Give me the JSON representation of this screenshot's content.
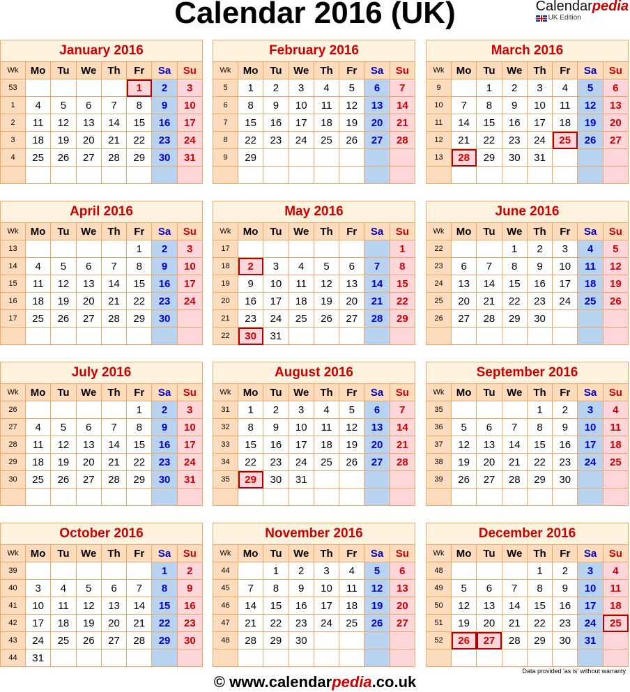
{
  "header": {
    "title": "Calendar 2016 (UK)",
    "brand_name_part1": "Calendar",
    "brand_name_part2": "pedia",
    "brand_edition": "UK Edition"
  },
  "weekday_headers": {
    "wk": "Wk",
    "days": [
      "Mo",
      "Tu",
      "We",
      "Th",
      "Fr",
      "Sa",
      "Su"
    ]
  },
  "colors": {
    "accent_red": "#cc0000",
    "saturday_blue": "#0000cc",
    "border_orange": "#f0a766",
    "header_peach": "#fddcbd",
    "saturday_bg": "#b8d3f0",
    "sunday_bg": "#ffd6d9"
  },
  "months": [
    {
      "title": "January 2016",
      "weeks": [
        {
          "wk": "53",
          "days": [
            "",
            "",
            "",
            "",
            "1",
            "2",
            "3"
          ],
          "hol": [
            4
          ]
        },
        {
          "wk": "1",
          "days": [
            "4",
            "5",
            "6",
            "7",
            "8",
            "9",
            "10"
          ]
        },
        {
          "wk": "2",
          "days": [
            "11",
            "12",
            "13",
            "14",
            "15",
            "16",
            "17"
          ]
        },
        {
          "wk": "3",
          "days": [
            "18",
            "19",
            "20",
            "21",
            "22",
            "23",
            "24"
          ]
        },
        {
          "wk": "4",
          "days": [
            "25",
            "26",
            "27",
            "28",
            "29",
            "30",
            "31"
          ]
        },
        {
          "wk": "",
          "days": [
            "",
            "",
            "",
            "",
            "",
            "",
            ""
          ]
        }
      ]
    },
    {
      "title": "February 2016",
      "weeks": [
        {
          "wk": "5",
          "days": [
            "1",
            "2",
            "3",
            "4",
            "5",
            "6",
            "7"
          ]
        },
        {
          "wk": "6",
          "days": [
            "8",
            "9",
            "10",
            "11",
            "12",
            "13",
            "14"
          ]
        },
        {
          "wk": "7",
          "days": [
            "15",
            "16",
            "17",
            "18",
            "19",
            "20",
            "21"
          ]
        },
        {
          "wk": "8",
          "days": [
            "22",
            "23",
            "24",
            "25",
            "26",
            "27",
            "28"
          ]
        },
        {
          "wk": "9",
          "days": [
            "29",
            "",
            "",
            "",
            "",
            "",
            ""
          ]
        },
        {
          "wk": "",
          "days": [
            "",
            "",
            "",
            "",
            "",
            "",
            ""
          ]
        }
      ]
    },
    {
      "title": "March 2016",
      "weeks": [
        {
          "wk": "9",
          "days": [
            "",
            "1",
            "2",
            "3",
            "4",
            "5",
            "6"
          ]
        },
        {
          "wk": "10",
          "days": [
            "7",
            "8",
            "9",
            "10",
            "11",
            "12",
            "13"
          ]
        },
        {
          "wk": "11",
          "days": [
            "14",
            "15",
            "16",
            "17",
            "18",
            "19",
            "20"
          ]
        },
        {
          "wk": "12",
          "days": [
            "21",
            "22",
            "23",
            "24",
            "25",
            "26",
            "27"
          ],
          "hol": [
            4
          ]
        },
        {
          "wk": "13",
          "days": [
            "28",
            "29",
            "30",
            "31",
            "",
            "",
            ""
          ],
          "hol": [
            0
          ]
        },
        {
          "wk": "",
          "days": [
            "",
            "",
            "",
            "",
            "",
            "",
            ""
          ]
        }
      ]
    },
    {
      "title": "April 2016",
      "weeks": [
        {
          "wk": "13",
          "days": [
            "",
            "",
            "",
            "",
            "1",
            "2",
            "3"
          ]
        },
        {
          "wk": "14",
          "days": [
            "4",
            "5",
            "6",
            "7",
            "8",
            "9",
            "10"
          ]
        },
        {
          "wk": "15",
          "days": [
            "11",
            "12",
            "13",
            "14",
            "15",
            "16",
            "17"
          ]
        },
        {
          "wk": "16",
          "days": [
            "18",
            "19",
            "20",
            "21",
            "22",
            "23",
            "24"
          ]
        },
        {
          "wk": "17",
          "days": [
            "25",
            "26",
            "27",
            "28",
            "29",
            "30",
            ""
          ]
        },
        {
          "wk": "",
          "days": [
            "",
            "",
            "",
            "",
            "",
            "",
            ""
          ]
        }
      ]
    },
    {
      "title": "May 2016",
      "weeks": [
        {
          "wk": "17",
          "days": [
            "",
            "",
            "",
            "",
            "",
            "",
            "1"
          ]
        },
        {
          "wk": "18",
          "days": [
            "2",
            "3",
            "4",
            "5",
            "6",
            "7",
            "8"
          ],
          "hol": [
            0
          ]
        },
        {
          "wk": "19",
          "days": [
            "9",
            "10",
            "11",
            "12",
            "13",
            "14",
            "15"
          ]
        },
        {
          "wk": "20",
          "days": [
            "16",
            "17",
            "18",
            "19",
            "20",
            "21",
            "22"
          ]
        },
        {
          "wk": "21",
          "days": [
            "23",
            "24",
            "25",
            "26",
            "27",
            "28",
            "29"
          ]
        },
        {
          "wk": "22",
          "days": [
            "30",
            "31",
            "",
            "",
            "",
            "",
            ""
          ],
          "hol": [
            0
          ]
        }
      ]
    },
    {
      "title": "June 2016",
      "weeks": [
        {
          "wk": "22",
          "days": [
            "",
            "",
            "1",
            "2",
            "3",
            "4",
            "5"
          ]
        },
        {
          "wk": "23",
          "days": [
            "6",
            "7",
            "8",
            "9",
            "10",
            "11",
            "12"
          ]
        },
        {
          "wk": "24",
          "days": [
            "13",
            "14",
            "15",
            "16",
            "17",
            "18",
            "19"
          ]
        },
        {
          "wk": "25",
          "days": [
            "20",
            "21",
            "22",
            "23",
            "24",
            "25",
            "26"
          ]
        },
        {
          "wk": "26",
          "days": [
            "27",
            "28",
            "29",
            "30",
            "",
            "",
            ""
          ]
        },
        {
          "wk": "",
          "days": [
            "",
            "",
            "",
            "",
            "",
            "",
            ""
          ]
        }
      ]
    },
    {
      "title": "July 2016",
      "weeks": [
        {
          "wk": "26",
          "days": [
            "",
            "",
            "",
            "",
            "1",
            "2",
            "3"
          ]
        },
        {
          "wk": "27",
          "days": [
            "4",
            "5",
            "6",
            "7",
            "8",
            "9",
            "10"
          ]
        },
        {
          "wk": "28",
          "days": [
            "11",
            "12",
            "13",
            "14",
            "15",
            "16",
            "17"
          ]
        },
        {
          "wk": "29",
          "days": [
            "18",
            "19",
            "20",
            "21",
            "22",
            "23",
            "24"
          ]
        },
        {
          "wk": "30",
          "days": [
            "25",
            "26",
            "27",
            "28",
            "29",
            "30",
            "31"
          ]
        },
        {
          "wk": "",
          "days": [
            "",
            "",
            "",
            "",
            "",
            "",
            ""
          ]
        }
      ]
    },
    {
      "title": "August 2016",
      "weeks": [
        {
          "wk": "31",
          "days": [
            "1",
            "2",
            "3",
            "4",
            "5",
            "6",
            "7"
          ]
        },
        {
          "wk": "32",
          "days": [
            "8",
            "9",
            "10",
            "11",
            "12",
            "13",
            "14"
          ]
        },
        {
          "wk": "33",
          "days": [
            "15",
            "16",
            "17",
            "18",
            "19",
            "20",
            "21"
          ]
        },
        {
          "wk": "34",
          "days": [
            "22",
            "23",
            "24",
            "25",
            "26",
            "27",
            "28"
          ]
        },
        {
          "wk": "35",
          "days": [
            "29",
            "30",
            "31",
            "",
            "",
            "",
            ""
          ],
          "hol": [
            0
          ]
        },
        {
          "wk": "",
          "days": [
            "",
            "",
            "",
            "",
            "",
            "",
            ""
          ]
        }
      ]
    },
    {
      "title": "September 2016",
      "weeks": [
        {
          "wk": "35",
          "days": [
            "",
            "",
            "",
            "1",
            "2",
            "3",
            "4"
          ]
        },
        {
          "wk": "36",
          "days": [
            "5",
            "6",
            "7",
            "8",
            "9",
            "10",
            "11"
          ]
        },
        {
          "wk": "37",
          "days": [
            "12",
            "13",
            "14",
            "15",
            "16",
            "17",
            "18"
          ]
        },
        {
          "wk": "38",
          "days": [
            "19",
            "20",
            "21",
            "22",
            "23",
            "24",
            "25"
          ]
        },
        {
          "wk": "39",
          "days": [
            "26",
            "27",
            "28",
            "29",
            "30",
            "",
            ""
          ]
        },
        {
          "wk": "",
          "days": [
            "",
            "",
            "",
            "",
            "",
            "",
            ""
          ]
        }
      ]
    },
    {
      "title": "October 2016",
      "weeks": [
        {
          "wk": "39",
          "days": [
            "",
            "",
            "",
            "",
            "",
            "1",
            "2"
          ]
        },
        {
          "wk": "40",
          "days": [
            "3",
            "4",
            "5",
            "6",
            "7",
            "8",
            "9"
          ]
        },
        {
          "wk": "41",
          "days": [
            "10",
            "11",
            "12",
            "13",
            "14",
            "15",
            "16"
          ]
        },
        {
          "wk": "42",
          "days": [
            "17",
            "18",
            "19",
            "20",
            "21",
            "22",
            "23"
          ]
        },
        {
          "wk": "43",
          "days": [
            "24",
            "25",
            "26",
            "27",
            "28",
            "29",
            "30"
          ]
        },
        {
          "wk": "44",
          "days": [
            "31",
            "",
            "",
            "",
            "",
            "",
            ""
          ]
        }
      ]
    },
    {
      "title": "November 2016",
      "weeks": [
        {
          "wk": "44",
          "days": [
            "",
            "1",
            "2",
            "3",
            "4",
            "5",
            "6"
          ]
        },
        {
          "wk": "45",
          "days": [
            "7",
            "8",
            "9",
            "10",
            "11",
            "12",
            "13"
          ]
        },
        {
          "wk": "46",
          "days": [
            "14",
            "15",
            "16",
            "17",
            "18",
            "19",
            "20"
          ]
        },
        {
          "wk": "47",
          "days": [
            "21",
            "22",
            "23",
            "24",
            "25",
            "26",
            "27"
          ]
        },
        {
          "wk": "48",
          "days": [
            "28",
            "29",
            "30",
            "",
            "",
            "",
            ""
          ]
        },
        {
          "wk": "",
          "days": [
            "",
            "",
            "",
            "",
            "",
            "",
            ""
          ]
        }
      ]
    },
    {
      "title": "December 2016",
      "weeks": [
        {
          "wk": "48",
          "days": [
            "",
            "",
            "",
            "1",
            "2",
            "3",
            "4"
          ]
        },
        {
          "wk": "49",
          "days": [
            "5",
            "6",
            "7",
            "8",
            "9",
            "10",
            "11"
          ]
        },
        {
          "wk": "50",
          "days": [
            "12",
            "13",
            "14",
            "15",
            "16",
            "17",
            "18"
          ]
        },
        {
          "wk": "51",
          "days": [
            "19",
            "20",
            "21",
            "22",
            "23",
            "24",
            "25"
          ],
          "hol": [
            6
          ]
        },
        {
          "wk": "52",
          "days": [
            "26",
            "27",
            "28",
            "29",
            "30",
            "31",
            ""
          ],
          "hol": [
            0,
            1
          ]
        },
        {
          "wk": "",
          "days": [
            "",
            "",
            "",
            "",
            "",
            "",
            ""
          ]
        }
      ]
    }
  ],
  "footer": {
    "copyright_symbol": "©",
    "url_part1": "www.calendar",
    "url_part2": "pedia",
    "url_part3": ".co.uk",
    "disclaimer": "Data provided 'as is' without warranty"
  }
}
